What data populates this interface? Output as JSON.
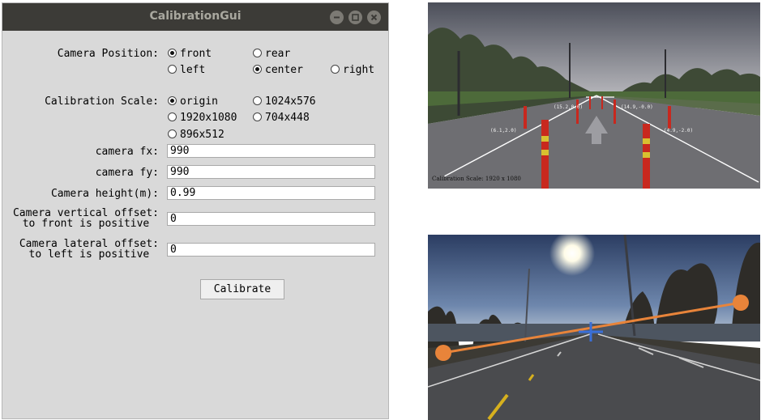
{
  "window": {
    "title": "CalibrationGui"
  },
  "camera_position": {
    "label": "Camera Position:",
    "options": [
      "front",
      "rear",
      "left",
      "center",
      "right"
    ],
    "selected": [
      "front",
      "center"
    ]
  },
  "calibration_scale": {
    "label": "Calibration Scale:",
    "options": [
      "origin",
      "1024x576",
      "1920x1080",
      "704x448",
      "896x512"
    ],
    "selected": "origin"
  },
  "fields": {
    "fx": {
      "label": "camera fx:",
      "value": "990"
    },
    "fy": {
      "label": "camera fy:",
      "value": "990"
    },
    "height": {
      "label": "Camera height(m):",
      "value": "0.99"
    },
    "vertical": {
      "label_line1": "Camera vertical offset:",
      "label_line2": "to front is positive",
      "value": "0"
    },
    "lateral": {
      "label_line1": "Camera lateral offset:",
      "label_line2": "to left is positive",
      "value": "0"
    }
  },
  "calibrate_button": "Calibrate",
  "top_image": {
    "overlay_labels": [
      "(15.2,0.0)",
      "(14.9,-0.0)",
      "(6.1,2.0)",
      "(4.9,-2.0)"
    ],
    "caption": "Calibration Scale: 1920 x 1080"
  },
  "colors": {
    "titlebar": "#3c3b37",
    "window_bg": "#d9d9d9",
    "horizon_line": "#e8843a",
    "cross_marker": "#3a6fd8"
  }
}
